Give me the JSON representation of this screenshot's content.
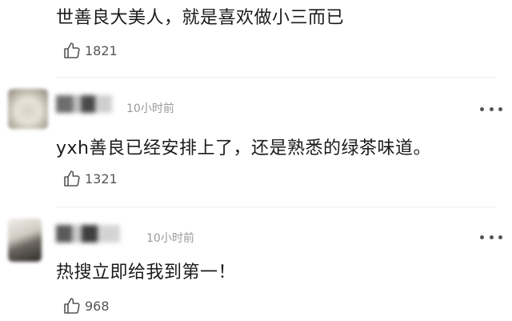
{
  "comments": [
    {
      "text": "世善良大美人，就是喜欢做小三而已",
      "likes": "1821"
    },
    {
      "time": "10小时前",
      "text": "yxh善良已经安排上了，还是熟悉的绿茶味道。",
      "likes": "1321"
    },
    {
      "time": "10小时前",
      "text": "热搜立即给我到第一！",
      "likes": "968"
    }
  ],
  "icons": {
    "like": "thumbs-up-icon",
    "more": "more-options-icon"
  }
}
